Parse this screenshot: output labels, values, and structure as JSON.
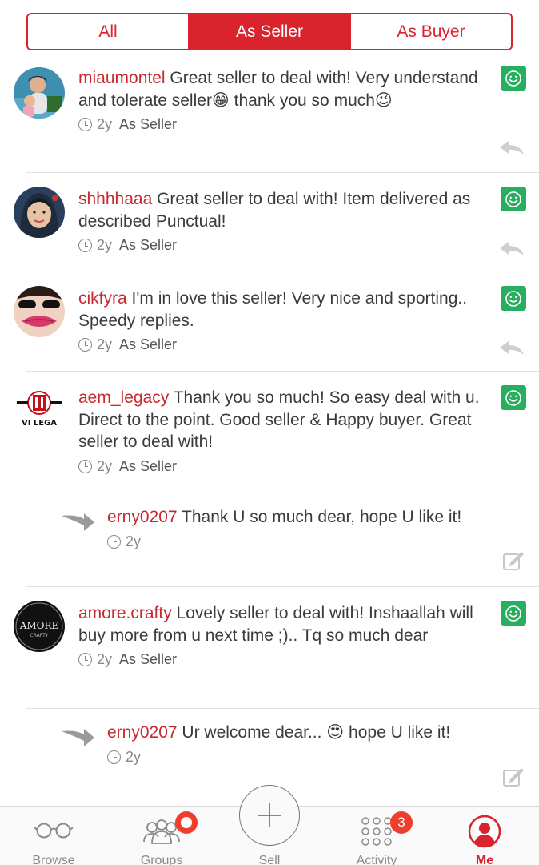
{
  "segments": {
    "all": "All",
    "as_seller": "As Seller",
    "as_buyer": "As Buyer"
  },
  "reviews": [
    {
      "username": "miaumontel",
      "text": " Great seller to deal with! Very understand and tolerate seller😁 thank you so much😉",
      "age": "2y",
      "role": "As Seller"
    },
    {
      "username": "shhhhaaa",
      "text": " Great seller to deal with! Item delivered as described Punctual!",
      "age": "2y",
      "role": "As Seller"
    },
    {
      "username": "cikfyra",
      "text": " I'm in love this seller! Very nice and sporting.. Speedy replies.",
      "age": "2y",
      "role": "As Seller"
    },
    {
      "username": "aem_legacy",
      "text": " Thank you so much! So easy deal with u. Direct to the point. Good seller & Happy buyer. Great seller to deal with!",
      "age": "2y",
      "role": "As Seller",
      "reply": {
        "username": "erny0207",
        "text": " Thank U so much dear, hope U like it!",
        "age": "2y"
      }
    },
    {
      "username": "amore.crafty",
      "text": " Lovely seller to deal with! Inshaallah will buy more from u next time ;).. Tq so much dear",
      "age": "2y",
      "role": "As Seller",
      "reply": {
        "username": "erny0207",
        "text": " Ur welcome dear... 😍 hope U like it!",
        "age": "2y"
      }
    }
  ],
  "avatar_text": {
    "legacy": "VI LEGA",
    "amore_top": "AMORE",
    "amore_bottom": "CRAFTY"
  },
  "tabbar": {
    "browse": "Browse",
    "groups": "Groups",
    "sell": "Sell",
    "activity": "Activity",
    "activity_badge": "3",
    "me": "Me"
  },
  "colors": {
    "accent": "#d9232d",
    "username": "#c62a2f",
    "positive": "#27ae5f"
  }
}
